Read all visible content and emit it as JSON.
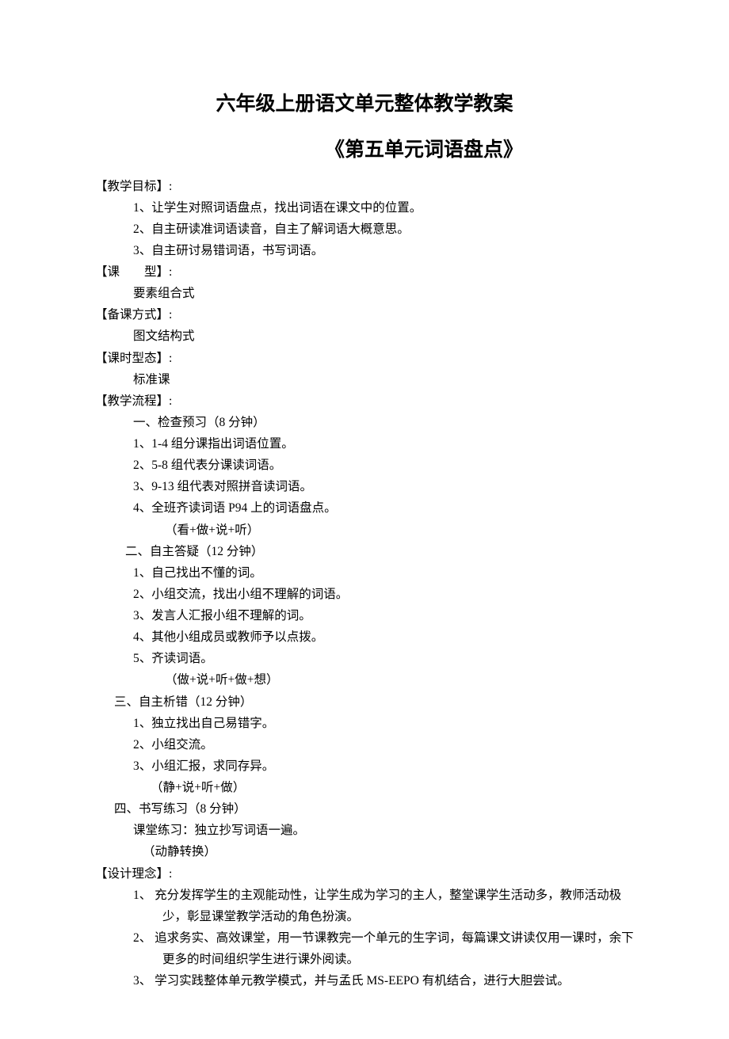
{
  "title1": "六年级上册语文单元整体教学教案",
  "title2": "《第五单元词语盘点》",
  "sections": {
    "goals": {
      "head": "【教学目标】:",
      "items": [
        "1、让学生对照词语盘点，找出词语在课文中的位置。",
        "2、自主研读准词语读音，自主了解词语大概意思。",
        "3、自主研讨易错词语，书写词语。"
      ]
    },
    "type": {
      "head": "【课　　型】:",
      "value": "要素组合式"
    },
    "prep": {
      "head": "【备课方式】:",
      "value": "图文结构式"
    },
    "period": {
      "head": "【课时型态】:",
      "value": "标准课"
    },
    "flow": {
      "head": "【教学流程】:",
      "part1": {
        "title": "一、检查预习（8 分钟）",
        "items": [
          "1、1-4 组分课指出词语位置。",
          "2、5-8 组代表分课读词语。",
          "3、9-13 组代表对照拼音读词语。",
          "4、全班齐读词语 P94 上的词语盘点。"
        ],
        "note": "（看+做+说+听）"
      },
      "part2": {
        "title": "二、自主答疑（12 分钟）",
        "items": [
          "1、自己找出不懂的词。",
          "2、小组交流，找出小组不理解的词语。",
          "3、发言人汇报小组不理解的词。",
          "4、其他小组成员或教师予以点拨。",
          "5、齐读词语。"
        ],
        "note": "（做+说+听+做+想）"
      },
      "part3": {
        "title": "三、自主析错（12 分钟）",
        "items": [
          "1、独立找出自己易错字。",
          "2、小组交流。",
          "3、小组汇报，求同存异。"
        ],
        "note": "（静+说+听+做）"
      },
      "part4": {
        "title": "四、书写练习（8 分钟）",
        "line": "课堂练习：独立抄写词语一遍。",
        "note": "（动静转换）"
      }
    },
    "design": {
      "head": "【设计理念】:",
      "items": [
        "1、 充分发挥学生的主观能动性，让学生成为学习的主人，整堂课学生活动多，教师活动极少，彰显课堂教学活动的角色扮演。",
        "2、 追求务实、高效课堂，用一节课教完一个单元的生字词，每篇课文讲读仅用一课时，余下更多的时间组织学生进行课外阅读。",
        "3、 学习实践整体单元教学模式，并与孟氏 MS-EEPO 有机结合，进行大胆尝试。"
      ]
    }
  }
}
